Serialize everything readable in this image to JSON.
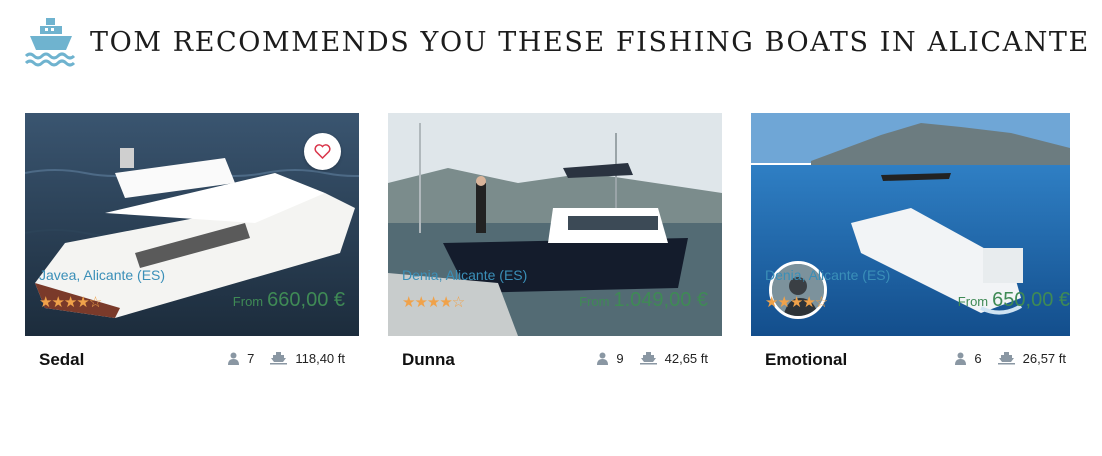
{
  "header": {
    "title": "TOM RECOMMENDS YOU THESE FISHING BOATS IN ALICANTE",
    "logo_icon": "boat-waves-icon"
  },
  "colors": {
    "accent": "#6fb3cf",
    "location": "#3a8fb8",
    "price": "#3f8a55",
    "stars": "#f0a24a"
  },
  "boats": [
    {
      "name": "Sedal",
      "guests": "7",
      "length": "118,40 ft",
      "location": "Javea, Alicante (ES)",
      "rating_stars": "★★★★☆",
      "rating": 4,
      "from_label": "From",
      "price": "660,00 €"
    },
    {
      "name": "Dunna",
      "guests": "9",
      "length": "42,65 ft",
      "location": "Denia, Alicante (ES)",
      "rating_stars": "★★★★☆",
      "rating": 4,
      "from_label": "From",
      "price": "1.049,00 €"
    },
    {
      "name": "Emotional",
      "guests": "6",
      "length": "26,57 ft",
      "location": "Denia, Alicante (ES)",
      "rating_stars": "★★★★☆",
      "rating": 4,
      "from_label": "From",
      "price": "650,00 €"
    }
  ]
}
